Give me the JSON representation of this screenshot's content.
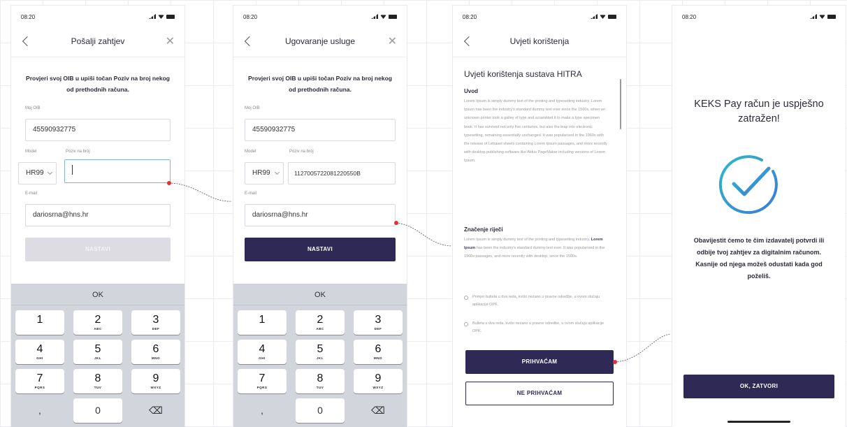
{
  "status_time": "08:20",
  "screen1": {
    "title": "Pošalji zahtjev",
    "instruction": "Provjeri svoj OIB u upiši točan Poziv na broj nekog od prethodnih računa.",
    "oib_label": "Moj OIB",
    "oib_value": "45590932775",
    "model_label": "Model",
    "model_value": "HR99",
    "ref_label": "Poziv na broj",
    "email_label": "E-mail",
    "email_value": "dariosrna@hns.hr",
    "button": "NASTAVI"
  },
  "screen2": {
    "title": "Ugovaranje usluge",
    "instruction": "Provjeri svoj OIB u upiši točan Poziv na broj nekog od prethodnih računa.",
    "oib_label": "Moj OIB",
    "oib_value": "45590932775",
    "model_label": "Model",
    "model_value": "HR99",
    "ref_label": "Poziv na broj",
    "ref_value": "1127005722081220550B",
    "email_label": "E-mail",
    "email_value": "dariosrna@hns.hr",
    "button": "NASTAVI"
  },
  "keyboard": {
    "ok": "OK",
    "keys": [
      {
        "n": "1",
        "l": ""
      },
      {
        "n": "2",
        "l": "ABC"
      },
      {
        "n": "3",
        "l": "DEF"
      },
      {
        "n": "4",
        "l": "GHI"
      },
      {
        "n": "5",
        "l": "JKL"
      },
      {
        "n": "6",
        "l": "MNO"
      },
      {
        "n": "7",
        "l": "PQRS"
      },
      {
        "n": "8",
        "l": "TUV"
      },
      {
        "n": "9",
        "l": "WXYZ"
      }
    ],
    "zero": "0",
    "dot": ",",
    "delete": "⌫"
  },
  "screen3": {
    "title": "Uvjeti korištenja",
    "heading": "Uvjeti korištenja sustava HITRA",
    "sub1": "Uvod",
    "para1": "Lorem Ipsum is simply dummy text of the printing and typesetting industry. Lorem Ipsum has been the industry's standard dummy text ever since the 1500s, when an unknown printer took a galley of type and scrambled it to make a type specimen book. It has survived not only five centuries, but also the leap into electronic typesetting, remaining essentially unchanged. It was popularised in the 1960s with the release of Letraset sheets containing Lorem Ipsum passages, and more recently with desktop publishing software like Aldus PageMaker including versions of Lorem Ipsum.",
    "sub2": "Značenje riječi",
    "para2_a": "Lorem Ipsum is simply dummy text of the printing and typesetting industry.",
    "para2_hl": "Lorem Ipsum",
    "para2_b": "has been the industry's standard dummy text ever. It was popularised in the 1960s passages, and more recently with desktop, since the 1500s.",
    "bullet1": "Primjer bulleta u dva reda, kvišo nezano u pravne odredbe, u ovom slučaju aplikacije OPK.",
    "bullet2": "Bulleta u dva reda, kvišo nezano u pravne odredbe, u ovom slučaju aplikacije OPK.",
    "accept": "PRIHVAĆAM",
    "decline": "NE PRIHVAĆAM"
  },
  "screen4": {
    "title": "KEKS Pay račun je uspješno zatražen!",
    "text": "Obavijestit ćemo te čim izdavatelj potvrdi ili odbije tvoj zahtjev za digitalnim računom. Kasnije od njega možeš odustati kada god poželiš.",
    "button": "OK, ZATVORI"
  },
  "colors": {
    "primary": "#2f2a55",
    "disabled": "#dcdce2",
    "connector": "#e0303a",
    "check_gradient_start": "#2fb9c8",
    "check_gradient_end": "#3d7ad9"
  }
}
